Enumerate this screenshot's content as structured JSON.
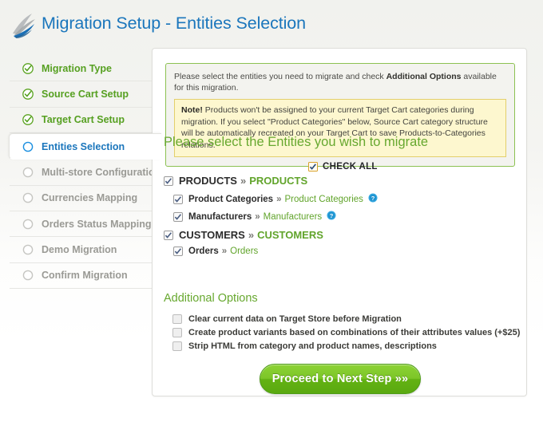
{
  "header": {
    "title": "Migration Setup - Entities Selection",
    "logo_icon": "swoosh-arrow-logo"
  },
  "sidebar": {
    "items": [
      {
        "label": "Migration Type",
        "state": "done"
      },
      {
        "label": "Source Cart Setup",
        "state": "done"
      },
      {
        "label": "Target Cart Setup",
        "state": "done"
      },
      {
        "label": "Entities Selection",
        "state": "active"
      },
      {
        "label": "Multi-store Configuration",
        "state": "pending"
      },
      {
        "label": "Currencies Mapping",
        "state": "pending"
      },
      {
        "label": "Orders Status Mapping",
        "state": "pending"
      },
      {
        "label": "Demo Migration",
        "state": "pending"
      },
      {
        "label": "Confirm Migration",
        "state": "pending"
      }
    ]
  },
  "notice": {
    "intro_before": "Please select the entities you need to migrate and check ",
    "intro_bold": "Additional Options",
    "intro_after": " available for this migration.",
    "note_label": "Note!",
    "note_text": " Products won't be assigned to your current Target Cart categories during migration. If you select \"Product Categories\" below, Source Cart category structure will be automatically recreated on your Target Cart to save Products-to-Categories relations."
  },
  "entities": {
    "heading": "Please select the Entities you wish to migrate",
    "check_all_label": "CHECK ALL",
    "check_all_checked": true,
    "rows": [
      {
        "source": "PRODUCTS",
        "arrow": "»",
        "target": "PRODUCTS",
        "level": "top",
        "checked": true,
        "help": false
      },
      {
        "source": "Product Categories",
        "arrow": "»",
        "target": "Product Categories",
        "level": "sub",
        "checked": true,
        "help": true
      },
      {
        "source": "Manufacturers",
        "arrow": "»",
        "target": "Manufacturers",
        "level": "sub",
        "checked": true,
        "help": true
      },
      {
        "source": "CUSTOMERS",
        "arrow": "»",
        "target": "CUSTOMERS",
        "level": "top",
        "checked": true,
        "help": false
      },
      {
        "source": "Orders",
        "arrow": "»",
        "target": "Orders",
        "level": "sub",
        "checked": true,
        "help": false
      }
    ]
  },
  "additional_options": {
    "heading": "Additional Options",
    "options": [
      {
        "label": "Clear current data on Target Store before Migration",
        "checked": false
      },
      {
        "label": "Create product variants based on combinations of their attributes values (+$25)",
        "checked": false
      },
      {
        "label": "Strip HTML from category and product names, descriptions",
        "checked": false
      }
    ]
  },
  "proceed": {
    "label": "Proceed to Next Step »»"
  },
  "colors": {
    "title_blue": "#1b76bc",
    "done_green": "#56a021",
    "heading_green": "#67a82f",
    "button_green": "#7cc628",
    "note_yellow": "#fdf7cf",
    "pending_gray": "#9a9a95"
  }
}
